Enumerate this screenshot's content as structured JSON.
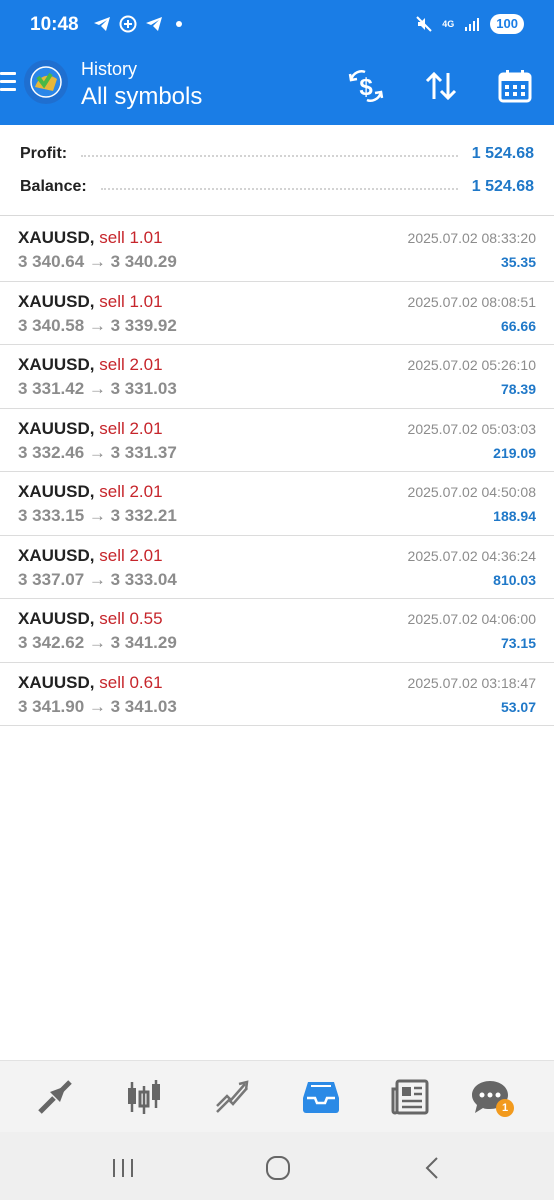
{
  "status_bar": {
    "time": "10:48",
    "network": "4G",
    "battery": "100"
  },
  "app_bar": {
    "section": "History",
    "filter": "All symbols",
    "icons": [
      "menu-icon",
      "app-logo",
      "dollar-exchange-icon",
      "sort-icon",
      "calendar-icon"
    ]
  },
  "summary": {
    "profit_label": "Profit:",
    "profit_value": "1 524.68",
    "balance_label": "Balance:",
    "balance_value": "1 524.68"
  },
  "deals": [
    {
      "symbol": "XAUUSD,",
      "side": "sell 1.01",
      "prices": "3 340.64 → 3 340.29",
      "time": "2025.07.02 08:33:20",
      "profit": "35.35"
    },
    {
      "symbol": "XAUUSD,",
      "side": "sell 1.01",
      "prices": "3 340.58 → 3 339.92",
      "time": "2025.07.02 08:08:51",
      "profit": "66.66"
    },
    {
      "symbol": "XAUUSD,",
      "side": "sell 2.01",
      "prices": "3 331.42 → 3 331.03",
      "time": "2025.07.02 05:26:10",
      "profit": "78.39"
    },
    {
      "symbol": "XAUUSD,",
      "side": "sell 2.01",
      "prices": "3 332.46 → 3 331.37",
      "time": "2025.07.02 05:03:03",
      "profit": "219.09"
    },
    {
      "symbol": "XAUUSD,",
      "side": "sell 2.01",
      "prices": "3 333.15 → 3 332.21",
      "time": "2025.07.02 04:50:08",
      "profit": "188.94"
    },
    {
      "symbol": "XAUUSD,",
      "side": "sell 2.01",
      "prices": "3 337.07 → 3 333.04",
      "time": "2025.07.02 04:36:24",
      "profit": "810.03"
    },
    {
      "symbol": "XAUUSD,",
      "side": "sell 0.55",
      "prices": "3 342.62 → 3 341.29",
      "time": "2025.07.02 04:06:00",
      "profit": "73.15"
    },
    {
      "symbol": "XAUUSD,",
      "side": "sell 0.61",
      "prices": "3 341.90 → 3 341.03",
      "time": "2025.07.02 03:18:47",
      "profit": "53.07"
    }
  ],
  "bottom_nav": {
    "items": [
      "quotes-icon",
      "chart-icon",
      "trade-icon",
      "history-icon",
      "news-icon",
      "chat-icon"
    ],
    "active": "history-icon",
    "chat_badge": "1"
  },
  "colors": {
    "header": "#1a7de6",
    "sell": "#c6252b",
    "profit": "#1f78c8",
    "muted": "#8c8c8c"
  }
}
